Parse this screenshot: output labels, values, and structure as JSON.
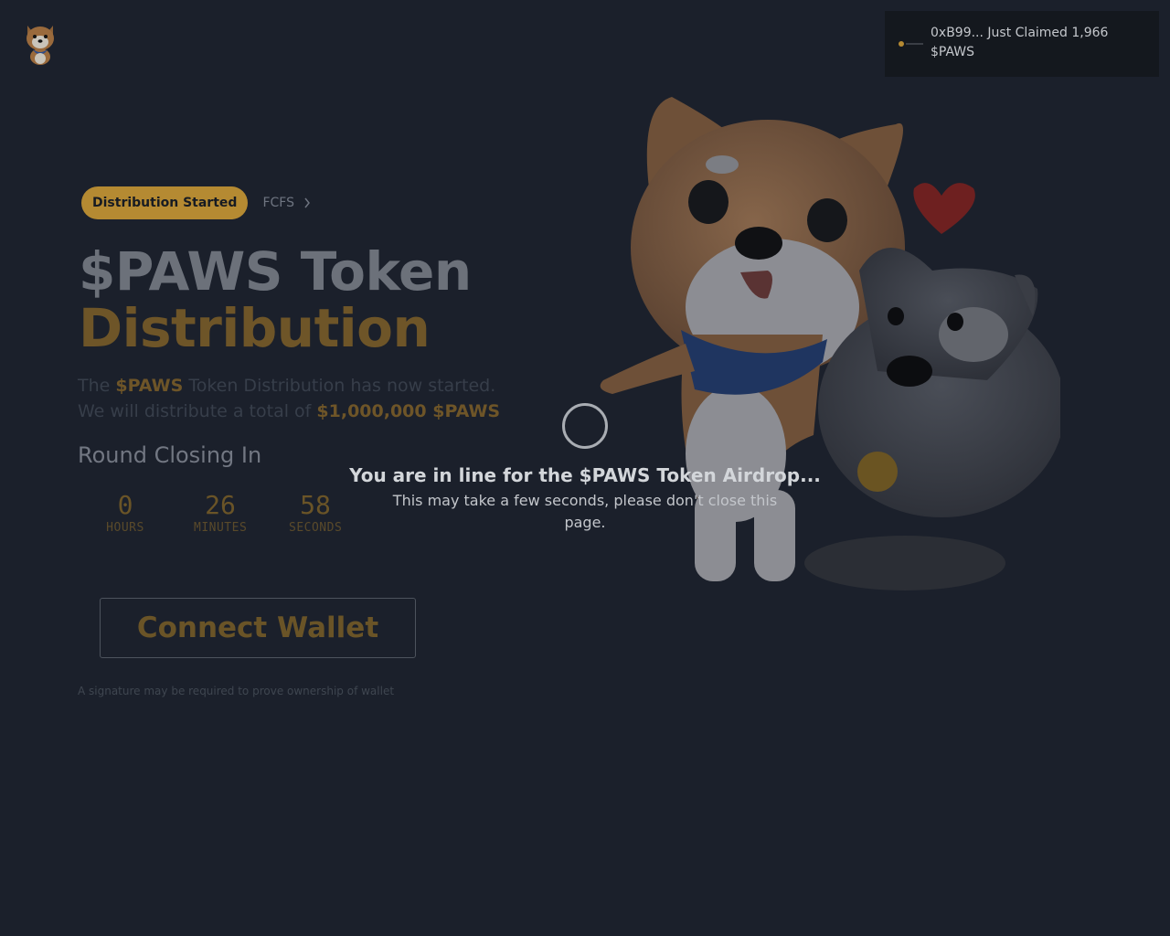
{
  "header": {
    "logo_icon": "shiba-dog-logo-icon"
  },
  "toast": {
    "icon": "token-coin-icon",
    "message": "0xB99... Just Claimed 1,966 $PAWS"
  },
  "hero": {
    "badge": "Distribution Started",
    "fcfs_label": "FCFS",
    "title_line1": "$PAWS Token",
    "title_line2": "Distribution",
    "desc_part1": "The ",
    "desc_token": "$PAWS",
    "desc_part2": " Token Distribution has now started.",
    "desc_part3": "We will distribute a total of ",
    "desc_amount": "$1,000,000 $PAWS",
    "round_label": "Round Closing In",
    "countdown": {
      "hours": "0",
      "hours_label": "HOURS",
      "minutes": "26",
      "minutes_label": "MINUTES",
      "seconds": "58",
      "seconds_label": "SECONDS"
    },
    "connect_label": "Connect Wallet",
    "signature_note": "A signature may be required to prove ownership of wallet"
  },
  "loader": {
    "title": "You are in line for the $PAWS Token Airdrop...",
    "subtitle": "This may take a few seconds, please don't close this page."
  },
  "colors": {
    "background": "#1b202b",
    "accent_gold": "#b58a32",
    "toast_bg": "#14181e"
  }
}
